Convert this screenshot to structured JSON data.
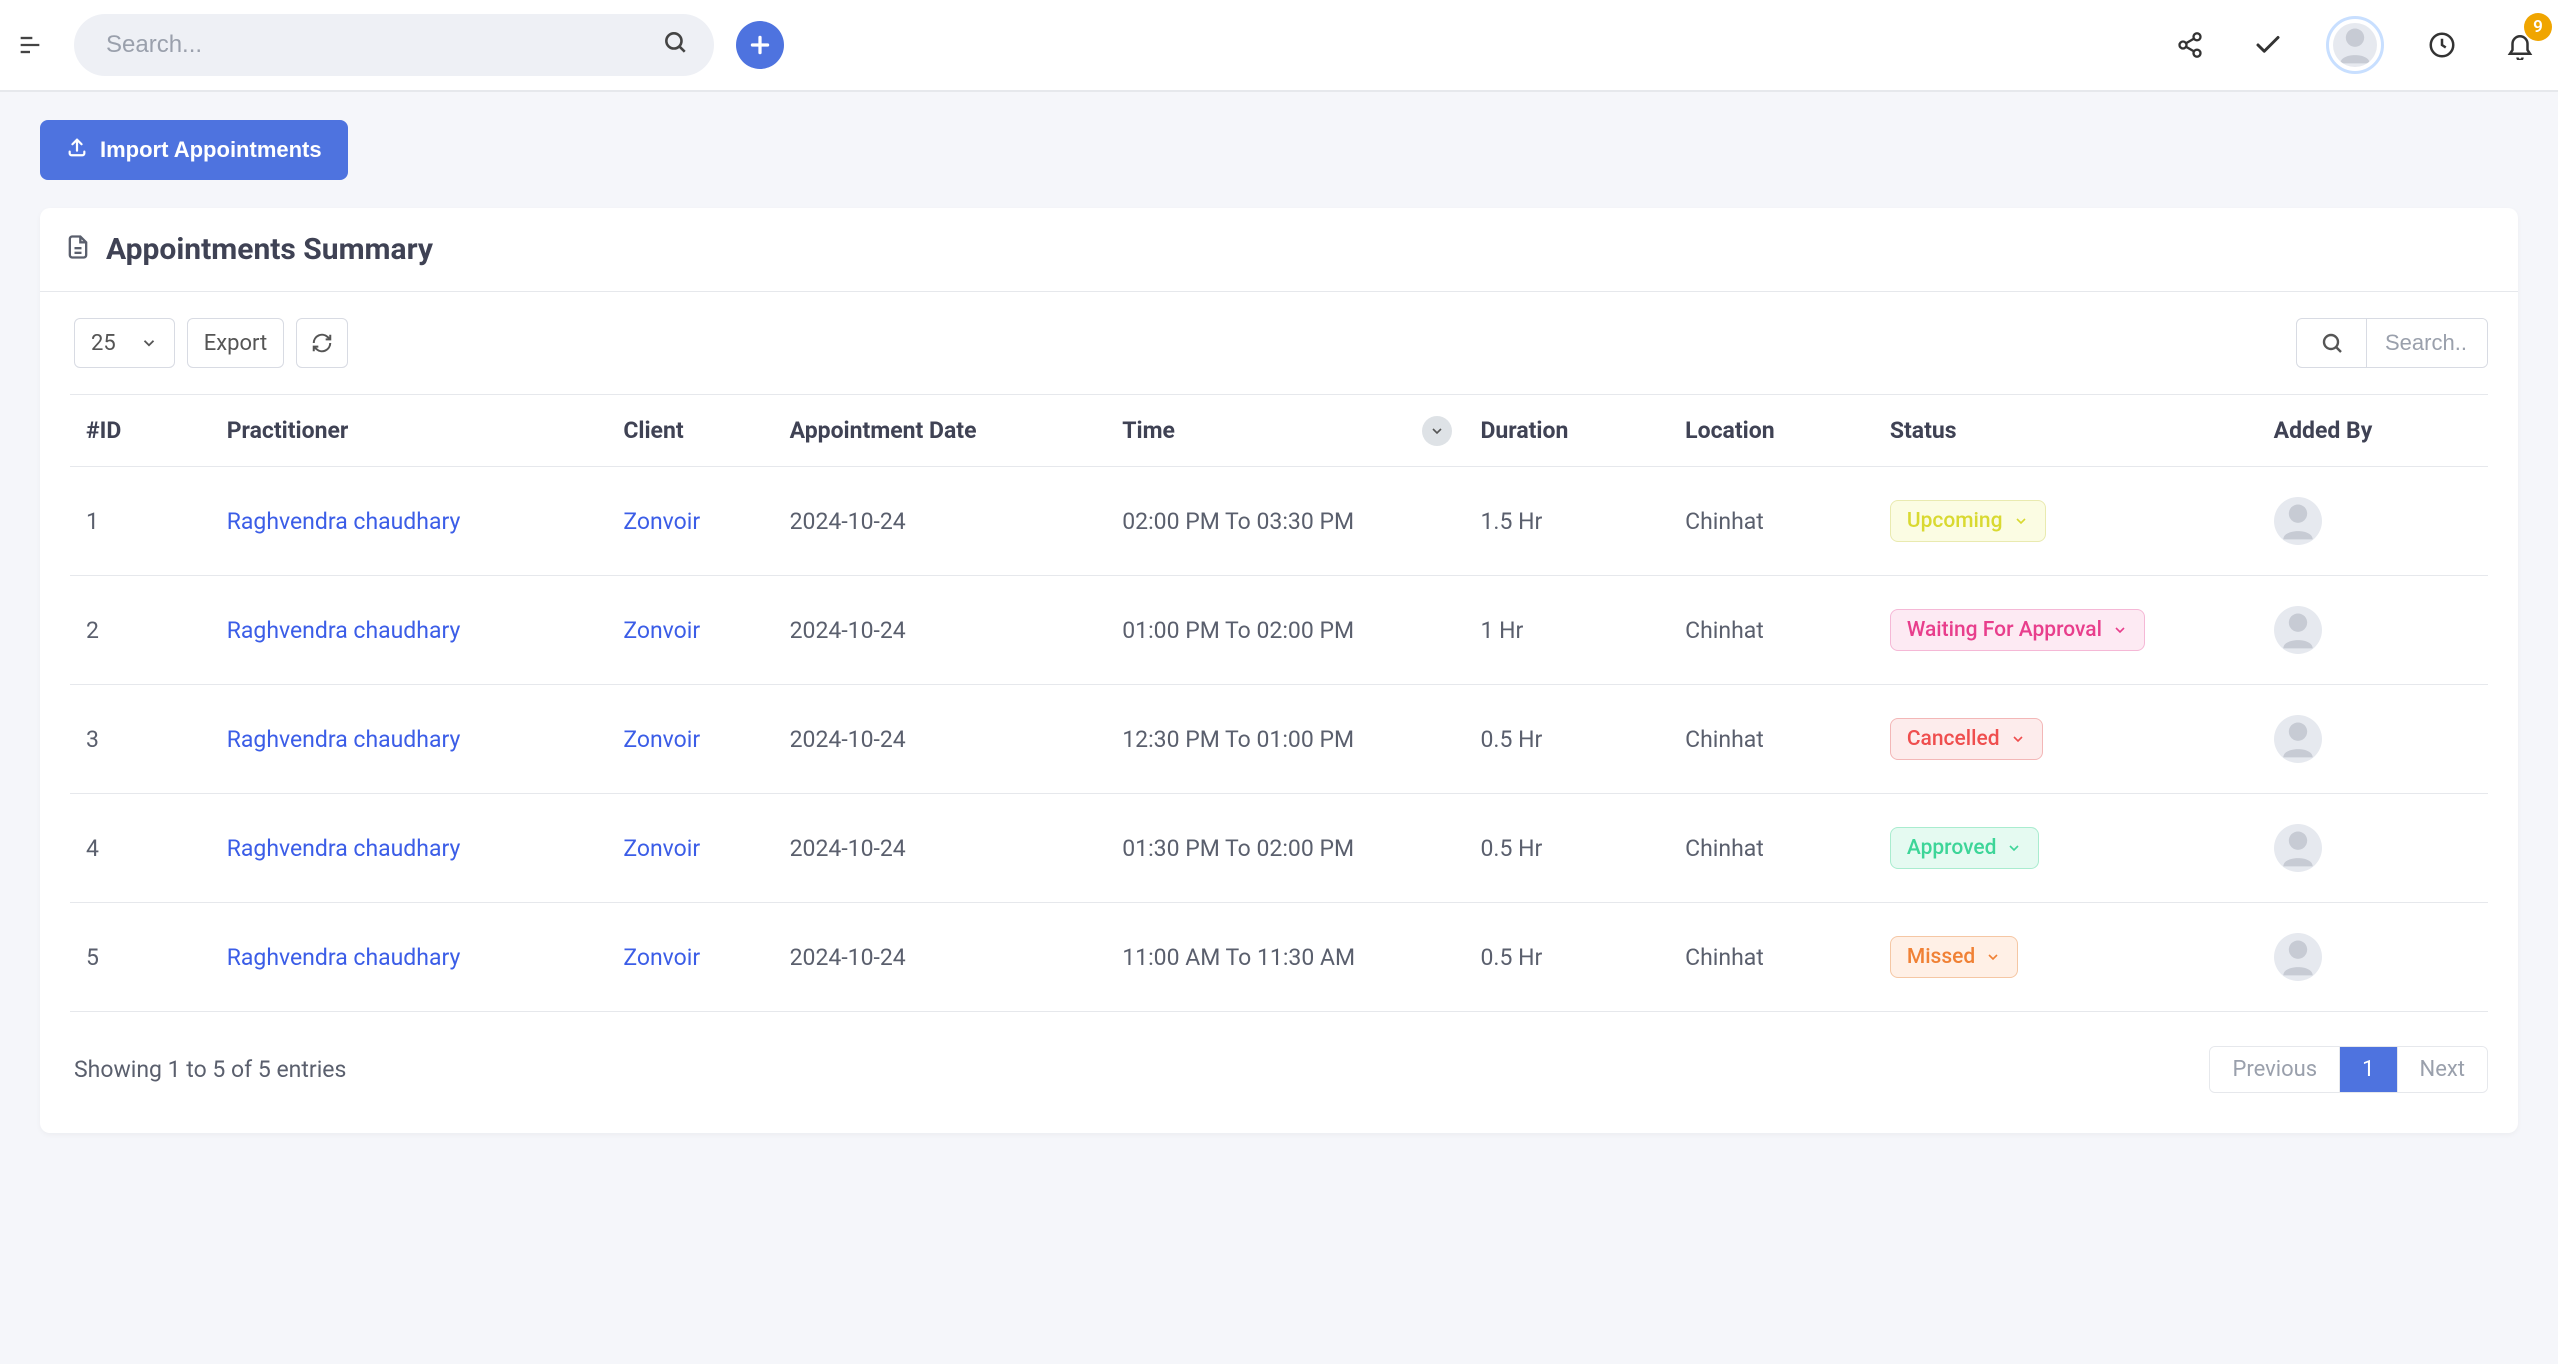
{
  "topbar": {
    "search_placeholder": "Search...",
    "notification_count": "9"
  },
  "actions": {
    "import_label": "Import Appointments"
  },
  "panel": {
    "title": "Appointments Summary"
  },
  "toolbar": {
    "page_size": "25",
    "export_label": "Export",
    "table_search_placeholder": "Search.."
  },
  "columns": {
    "id": "#ID",
    "practitioner": "Practitioner",
    "client": "Client",
    "date": "Appointment Date",
    "time": "Time",
    "duration": "Duration",
    "location": "Location",
    "status": "Status",
    "added_by": "Added By"
  },
  "rows": [
    {
      "id": "1",
      "practitioner": "Raghvendra chaudhary",
      "client": "Zonvoir",
      "date": "2024-10-24",
      "time": "02:00 PM To 03:30 PM",
      "duration": "1.5 Hr",
      "location": "Chinhat",
      "status_key": "upcoming",
      "status_label": "Upcoming"
    },
    {
      "id": "2",
      "practitioner": "Raghvendra chaudhary",
      "client": "Zonvoir",
      "date": "2024-10-24",
      "time": "01:00 PM To 02:00 PM",
      "duration": "1 Hr",
      "location": "Chinhat",
      "status_key": "waiting",
      "status_label": "Waiting For Approval"
    },
    {
      "id": "3",
      "practitioner": "Raghvendra chaudhary",
      "client": "Zonvoir",
      "date": "2024-10-24",
      "time": "12:30 PM To 01:00 PM",
      "duration": "0.5 Hr",
      "location": "Chinhat",
      "status_key": "cancelled",
      "status_label": "Cancelled"
    },
    {
      "id": "4",
      "practitioner": "Raghvendra chaudhary",
      "client": "Zonvoir",
      "date": "2024-10-24",
      "time": "01:30 PM To 02:00 PM",
      "duration": "0.5 Hr",
      "location": "Chinhat",
      "status_key": "approved",
      "status_label": "Approved"
    },
    {
      "id": "5",
      "practitioner": "Raghvendra chaudhary",
      "client": "Zonvoir",
      "date": "2024-10-24",
      "time": "11:00 AM To 11:30 AM",
      "duration": "0.5 Hr",
      "location": "Chinhat",
      "status_key": "missed",
      "status_label": "Missed"
    }
  ],
  "status_class_map": {
    "upcoming": "sp-upcoming",
    "waiting": "sp-waiting",
    "cancelled": "sp-cancelled",
    "approved": "sp-approved",
    "missed": "sp-missed"
  },
  "footer": {
    "showing_text": "Showing 1 to 5 of 5 entries",
    "prev_label": "Previous",
    "page_label": "1",
    "next_label": "Next"
  }
}
